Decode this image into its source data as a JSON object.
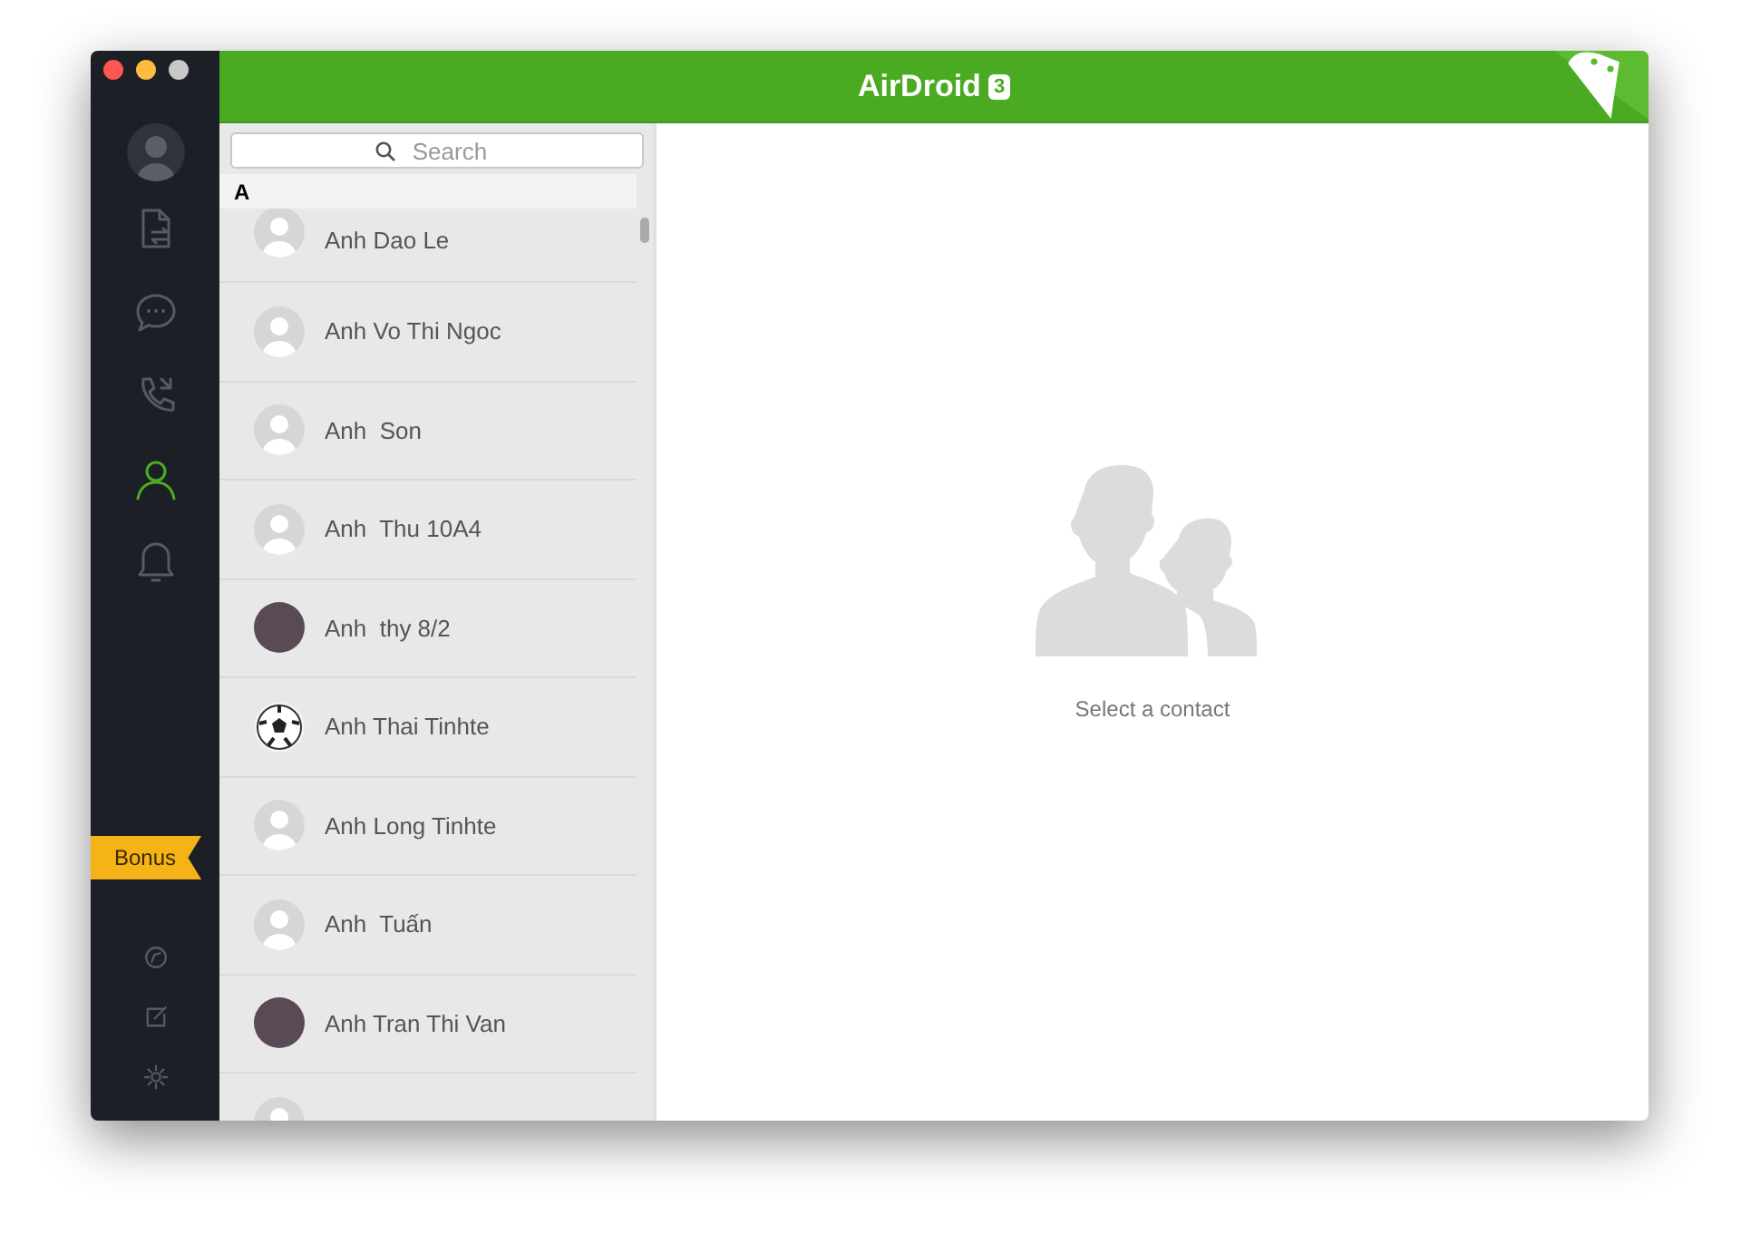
{
  "window": {
    "title": "AirDroid",
    "version_badge": "3"
  },
  "sidebar": {
    "items": [
      {
        "kind": "files",
        "selected": false
      },
      {
        "kind": "messages",
        "selected": false
      },
      {
        "kind": "calls",
        "selected": false
      },
      {
        "kind": "contacts",
        "selected": true
      },
      {
        "kind": "notifications",
        "selected": false
      }
    ],
    "bonus": "Bonus",
    "bottom_items": [
      {
        "kind": "compass"
      },
      {
        "kind": "edit"
      },
      {
        "kind": "settings"
      }
    ]
  },
  "search": {
    "placeholder": "Search"
  },
  "contacts": {
    "section": "A",
    "rows": [
      {
        "name": "Anh Dao Le",
        "kind": "default"
      },
      {
        "name": "Anh Vo Thi Ngoc",
        "kind": "default"
      },
      {
        "name": "Anh  Son",
        "kind": "default"
      },
      {
        "name": "Anh  Thu 10A4",
        "kind": "default"
      },
      {
        "name": "Anh  thy 8/2",
        "kind": "photo"
      },
      {
        "name": "Anh Thai Tinhte",
        "kind": "ball"
      },
      {
        "name": "Anh Long Tinhte",
        "kind": "default"
      },
      {
        "name": "Anh  Tuấn",
        "kind": "default"
      },
      {
        "name": "Anh Tran Thi Van",
        "kind": "photo"
      },
      {
        "kind": "default"
      }
    ]
  },
  "detail": {
    "empty_text": "Select a contact"
  }
}
